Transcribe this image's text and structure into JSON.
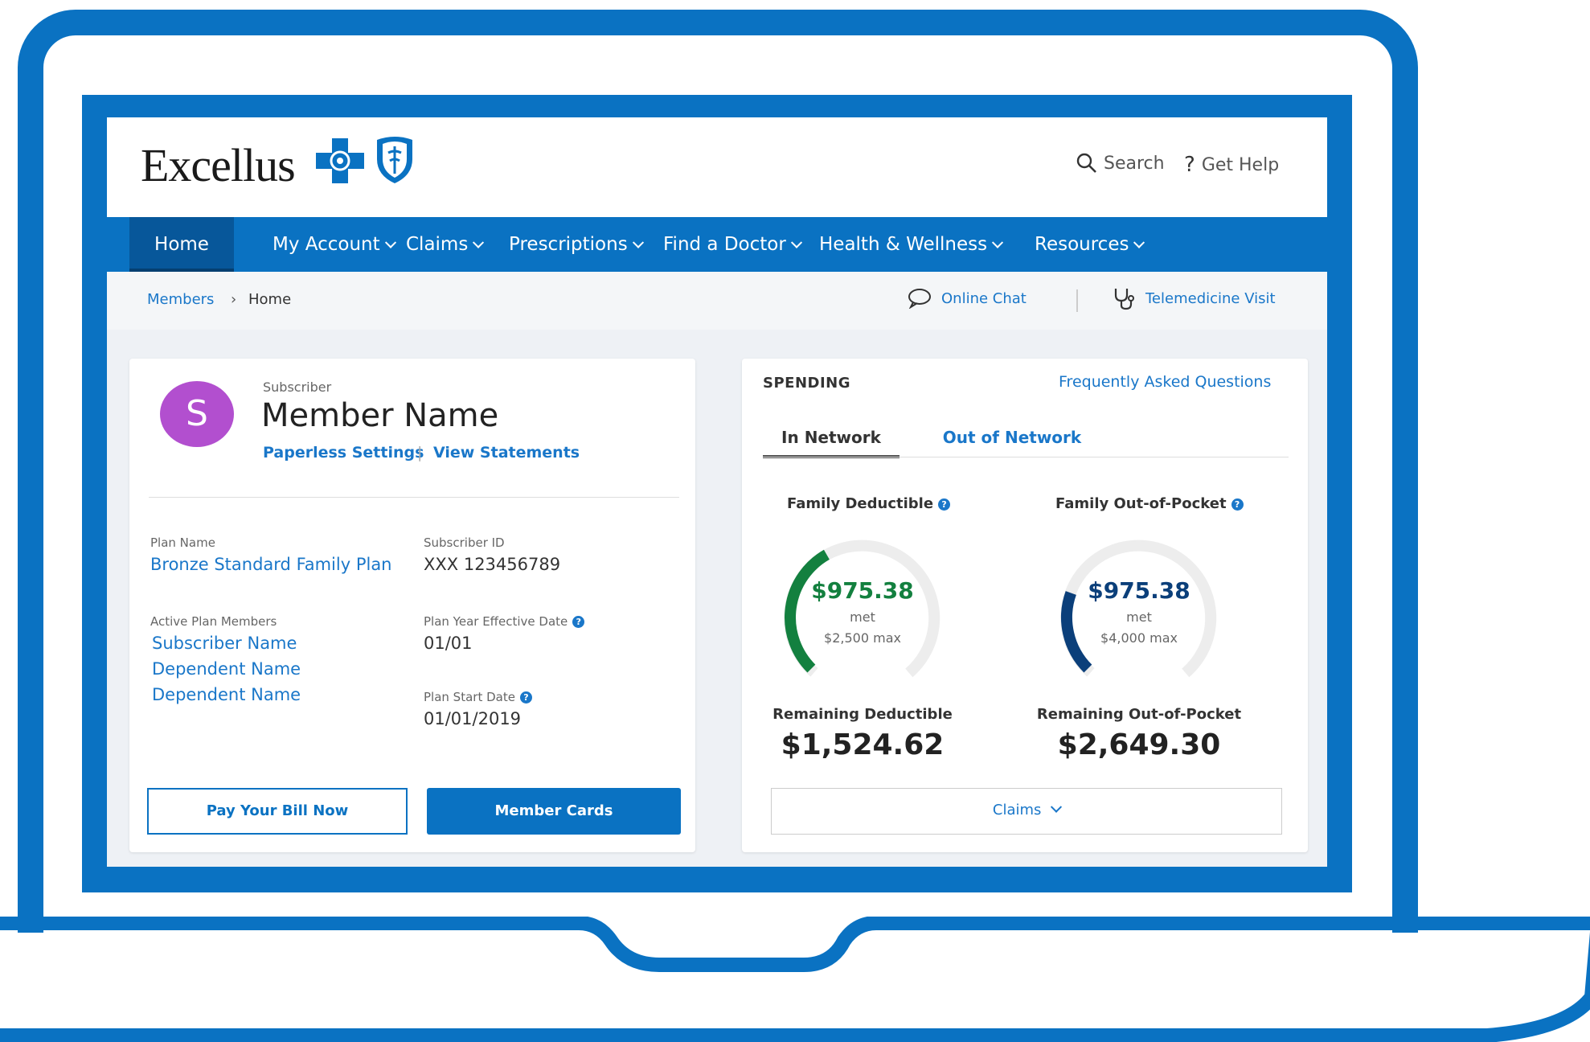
{
  "header": {
    "logo_text": "Excellus",
    "search_label": "Search",
    "help_label": "Get Help"
  },
  "nav": {
    "items": [
      "Home",
      "My Account",
      "Claims",
      "Prescriptions",
      "Find a Doctor",
      "Health & Wellness",
      "Resources"
    ]
  },
  "breadcrumb": {
    "root": "Members",
    "separator": "›",
    "current": "Home",
    "online_chat": "Online Chat",
    "telemedicine": "Telemedicine Visit"
  },
  "member": {
    "avatar_initial": "S",
    "role": "Subscriber",
    "name": "Member Name",
    "paperless": "Paperless Settings",
    "divider": "|",
    "statements": "View Statements",
    "plan_name_label": "Plan Name",
    "plan_name": "Bronze Standard Family Plan",
    "subscriber_id_label": "Subscriber ID",
    "subscriber_id": "XXX 123456789",
    "active_members_label": "Active Plan Members",
    "active_members": [
      "Subscriber Name",
      "Dependent Name",
      "Dependent Name"
    ],
    "effective_date_label": "Plan Year Effective Date",
    "effective_date": "01/01",
    "start_date_label": "Plan Start Date",
    "start_date": "01/01/2019",
    "pay_bill": "Pay Your Bill Now",
    "member_cards": "Member Cards"
  },
  "spending": {
    "title": "SPENDING",
    "faq": "Frequently Asked Questions",
    "tabs": [
      "In Network",
      "Out of Network"
    ],
    "deductible": {
      "title": "Family Deductible",
      "met_amount": "$975.38",
      "met_label": "met",
      "max": "$2,500 max",
      "fraction": 0.39,
      "remaining_label": "Remaining Deductible",
      "remaining": "$1,524.62"
    },
    "oop": {
      "title": "Family Out-of-Pocket",
      "met_amount": "$975.38",
      "met_label": "met",
      "max": "$4,000 max",
      "fraction": 0.24,
      "remaining_label": "Remaining Out-of-Pocket",
      "remaining": "$2,649.30"
    },
    "claims_button": "Claims"
  },
  "colors": {
    "brand_blue": "#0a72c2",
    "deductible_green": "#13803f",
    "oop_navy": "#0b3f7a",
    "avatar_purple": "#b24fcf"
  }
}
